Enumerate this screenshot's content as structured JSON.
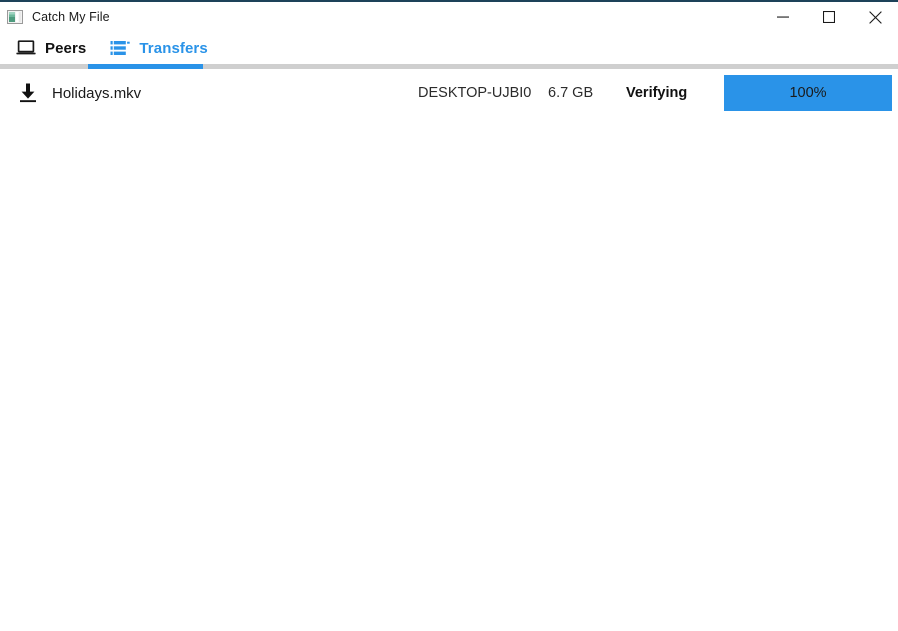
{
  "window": {
    "title": "Catch My File",
    "app_icon": "picture-app-icon",
    "controls": [
      {
        "name": "minimize",
        "glyph": "minimize-icon"
      },
      {
        "name": "maximize",
        "glyph": "maximize-icon"
      },
      {
        "name": "close",
        "glyph": "close-icon"
      }
    ]
  },
  "tabs": {
    "active": "Transfers",
    "items": [
      {
        "label": "Peers",
        "icon": "laptop-icon",
        "active": false
      },
      {
        "label": "Transfers",
        "icon": "list-icon",
        "active": true
      }
    ],
    "accent_color": "#2a93e8",
    "divider_color": "#cfcfcf"
  },
  "transfers": {
    "rows": [
      {
        "icon": "download-icon",
        "filename": "Holidays.mkv",
        "peer": "DESKTOP-UJBI0",
        "size": "6.7 GB",
        "status": "Verifying",
        "progress_label": "100%",
        "progress_percent": 100,
        "progress_color": "#2a93e8"
      }
    ]
  }
}
